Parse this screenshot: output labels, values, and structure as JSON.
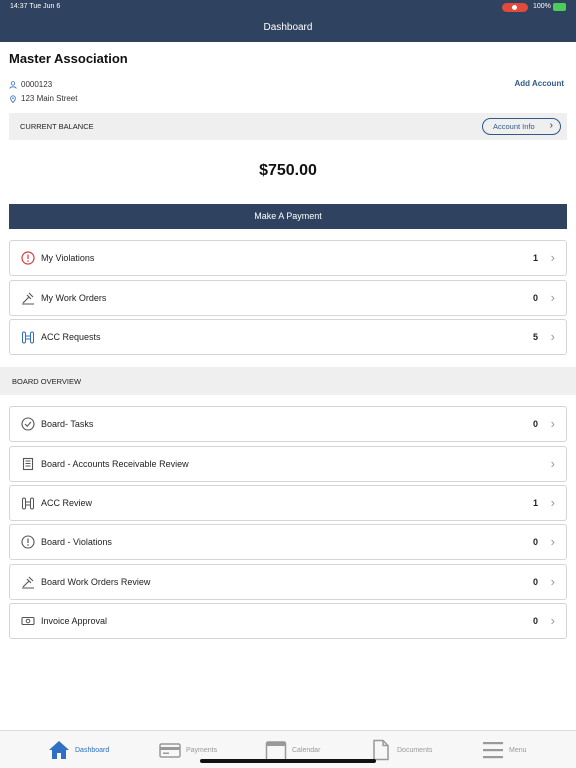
{
  "status": {
    "time": "14:37 Tue Jun 6",
    "battery": "100%"
  },
  "nav": {
    "title": "Dashboard"
  },
  "association": {
    "name": "Master Association",
    "account_number": "0000123",
    "address": "123 Main Street",
    "add_account": "Add Account"
  },
  "balance": {
    "label": "CURRENT BALANCE",
    "account_info": "Account Info",
    "amount": "$750.00",
    "pay_button": "Make A Payment"
  },
  "items": [
    {
      "label": "My Violations",
      "count": "1",
      "icon": "alert-circle-icon"
    },
    {
      "label": "My Work Orders",
      "count": "0",
      "icon": "hammer-icon"
    },
    {
      "label": "ACC Requests",
      "count": "5",
      "icon": "building-icon"
    }
  ],
  "board": {
    "title": "BOARD OVERVIEW",
    "items": [
      {
        "label": "Board- Tasks",
        "count": "0",
        "icon": "check-circle-icon"
      },
      {
        "label": "Board - Accounts Receivable Review",
        "count": "",
        "icon": "ledger-icon"
      },
      {
        "label": "ACC Review",
        "count": "1",
        "icon": "building-icon"
      },
      {
        "label": "Board - Violations",
        "count": "0",
        "icon": "alert-circle-icon"
      },
      {
        "label": "Board Work Orders Review",
        "count": "0",
        "icon": "hammer-icon"
      },
      {
        "label": "Invoice Approval",
        "count": "0",
        "icon": "cash-icon"
      }
    ]
  },
  "tabs": [
    {
      "label": "Dashboard",
      "icon": "home-icon",
      "active": true
    },
    {
      "label": "Payments",
      "icon": "credit-card-icon",
      "active": false
    },
    {
      "label": "Calendar",
      "icon": "calendar-icon",
      "active": false
    },
    {
      "label": "Documents",
      "icon": "document-icon",
      "active": false
    },
    {
      "label": "Menu",
      "icon": "menu-icon",
      "active": false
    }
  ],
  "colors": {
    "header": "#2f4260",
    "accent": "#2f5a8a",
    "alert": "#d93a3a",
    "active_tab": "#2f6fc4"
  }
}
